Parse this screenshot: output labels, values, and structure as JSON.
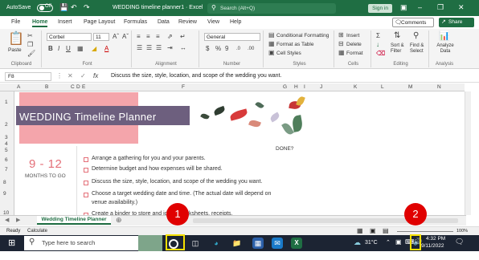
{
  "titlebar": {
    "autosave_label": "AutoSave",
    "autosave_state": "Off",
    "doc_title": "WEDDING timeline planner1 · Excel",
    "search_placeholder": "Search (Alt+Q)",
    "signin_label": "Sign in"
  },
  "menu": {
    "tabs": [
      "File",
      "Home",
      "Insert",
      "Page Layout",
      "Formulas",
      "Data",
      "Review",
      "View",
      "Help"
    ],
    "comments_label": "Comments",
    "share_label": "Share"
  },
  "ribbon": {
    "paste_label": "Paste",
    "font_name": "Corbel",
    "font_size": "11",
    "number_format": "General",
    "conditional_formatting": "Conditional Formatting",
    "format_as_table": "Format as Table",
    "cell_styles": "Cell Styles",
    "insert_label": "Insert",
    "delete_label": "Delete",
    "format_label": "Format",
    "sort_filter": "Sort & Filter",
    "find_select": "Find & Select",
    "analyze_data": "Analyze Data",
    "groups": [
      "Clipboard",
      "Font",
      "Alignment",
      "Number",
      "Styles",
      "Cells",
      "Editing",
      "Analysis"
    ]
  },
  "formula_bar": {
    "name_box": "F8",
    "fx": "fx",
    "content": "Discuss the size, style, location, and scope of the wedding you want."
  },
  "columns": [
    "A",
    "B",
    "C",
    "D",
    "E",
    "F",
    "G",
    "H",
    "I",
    "J",
    "K",
    "L",
    "M",
    "N"
  ],
  "rows": [
    "1",
    "2",
    "3",
    "4",
    "5",
    "6",
    "7",
    "8",
    "9",
    "10"
  ],
  "sheet": {
    "title": "WEDDING Timeline Planner",
    "done_label": "DONE?",
    "months_value": "9 - 12",
    "months_label": "MONTHS TO GO",
    "tasks": [
      "Arrange a gathering for you and your parents.",
      "Determine budget and how expenses will be shared.",
      "Discuss the size, style, location, and scope of the wedding you want.",
      "Choose a target wedding date and time. (The actual date will depend on",
      "venue availability.)",
      "Create a binder to store and        ideas, worksheets, receipts,"
    ]
  },
  "sheet_tab": "Wedding Timeline Planner",
  "status": {
    "ready": "Ready",
    "calculate": "Calculate",
    "zoom": "100%"
  },
  "taskbar": {
    "search_placeholder": "Type here to search",
    "temperature": "31°C",
    "time": "4:32 PM",
    "date": "9/11/2022"
  },
  "markers": [
    "1",
    "2"
  ],
  "colors": {
    "excel_green": "#1f6e43",
    "banner_pink": "#f4a5ab",
    "title_purple": "#6d5f7e",
    "accent_red": "#e46f78",
    "marker_red": "#e00000",
    "highlight_yellow": "#f5e000"
  }
}
